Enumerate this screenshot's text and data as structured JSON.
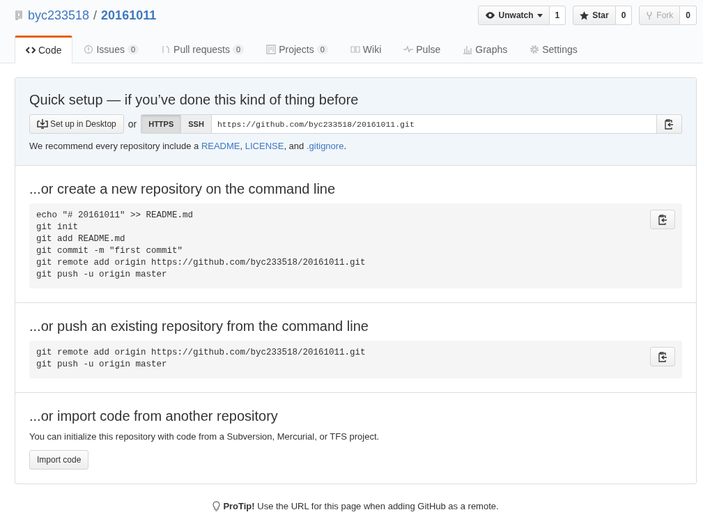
{
  "repo": {
    "owner": "byc233518",
    "separator": "/",
    "name": "20161011"
  },
  "actions": [
    {
      "label": "Unwatch",
      "count": "1",
      "has_caret": true,
      "disabled": false
    },
    {
      "label": "Star",
      "count": "0",
      "has_caret": false,
      "disabled": false
    },
    {
      "label": "Fork",
      "count": "0",
      "has_caret": false,
      "disabled": true
    }
  ],
  "tabs": [
    {
      "label": "Code",
      "selected": true
    },
    {
      "label": "Issues",
      "count": "0",
      "selected": false
    },
    {
      "label": "Pull requests",
      "count": "0",
      "selected": false
    },
    {
      "label": "Projects",
      "count": "0",
      "selected": false
    },
    {
      "label": "Wiki",
      "selected": false
    },
    {
      "label": "Pulse",
      "selected": false
    },
    {
      "label": "Graphs",
      "selected": false
    },
    {
      "label": "Settings",
      "selected": false
    }
  ],
  "quick_setup": {
    "title": "Quick setup — if you’ve done this kind of thing before",
    "desktop_button": "Set up in Desktop",
    "or": "or",
    "protocols": [
      {
        "label": "HTTPS",
        "selected": true
      },
      {
        "label": "SSH",
        "selected": false
      }
    ],
    "url": "https://github.com/byc233518/20161011.git",
    "recommend": [
      {
        "kind": "text",
        "text": "We recommend every repository include a "
      },
      {
        "kind": "link",
        "text": "README"
      },
      {
        "kind": "text",
        "text": ", "
      },
      {
        "kind": "link",
        "text": "LICENSE"
      },
      {
        "kind": "text",
        "text": ", and "
      },
      {
        "kind": "link",
        "text": ".gitignore"
      },
      {
        "kind": "text",
        "text": "."
      }
    ]
  },
  "sections": [
    {
      "kind": "code",
      "title": "...or create a new repository on the command line",
      "lines": [
        "echo \"# 20161011\" >> README.md",
        "git init",
        "git add README.md",
        "git commit -m \"first commit\"",
        "git remote add origin https://github.com/byc233518/20161011.git",
        "git push -u origin master"
      ]
    },
    {
      "kind": "code",
      "title": "...or push an existing repository from the command line",
      "lines": [
        "git remote add origin https://github.com/byc233518/20161011.git",
        "git push -u origin master"
      ]
    },
    {
      "kind": "import",
      "title": "...or import code from another repository",
      "text": "You can initialize this repository with code from a Subversion, Mercurial, or TFS project.",
      "button": "Import code"
    }
  ],
  "protip": {
    "label": "ProTip!",
    "text": "Use the URL for this page when adding GitHub as a remote."
  }
}
